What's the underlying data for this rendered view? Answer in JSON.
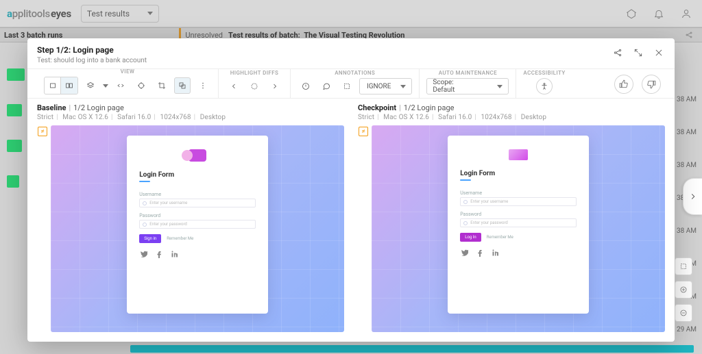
{
  "brand": {
    "applit": "applitools",
    "eyes": "eyes"
  },
  "topnav": {
    "dropdown_label": "Test results"
  },
  "crumb": {
    "left": "Last 3 batch runs",
    "status": "Unresolved",
    "prefix": "Test results of batch:",
    "batch_name": "The Visual Testing Revolution"
  },
  "modal": {
    "title": "Step 1/2:  Login page",
    "subtitle": "Test: should log into a bank account",
    "toolbar": {
      "groups": {
        "view": "VIEW",
        "highlight": "HIGHLIGHT DIFFS",
        "annotations": "ANNOTATIONS",
        "auto": "AUTO MAINTENANCE",
        "accessibility": "ACCESSIBILITY"
      },
      "ignore_label": "IGNORE",
      "scope_label": "Scope: Default"
    },
    "baseline": {
      "title": "Baseline",
      "step": "1/2 Login page",
      "meta": {
        "mode": "Strict",
        "os": "Mac OS X 12.6",
        "browser": "Safari 16.0",
        "viewport": "1024x768",
        "device": "Desktop"
      }
    },
    "checkpoint": {
      "title": "Checkpoint",
      "step": "1/2 Login page",
      "meta": {
        "mode": "Strict",
        "os": "Mac OS X 12.6",
        "browser": "Safari 16.0",
        "viewport": "1024x768",
        "device": "Desktop"
      }
    },
    "card": {
      "title": "Login Form",
      "user_label": "Username",
      "user_ph": "Enter your username",
      "pass_label": "Password",
      "pass_ph": "Enter your password",
      "signin": "Sign in",
      "login": "Log In",
      "remember": "Remember Me"
    },
    "diff_badge": "≠"
  },
  "times": [
    "38 AM",
    "38 AM",
    "38 AM",
    "38 AM",
    "38 AM",
    "38 AM",
    "38 AM",
    "29 AM"
  ]
}
